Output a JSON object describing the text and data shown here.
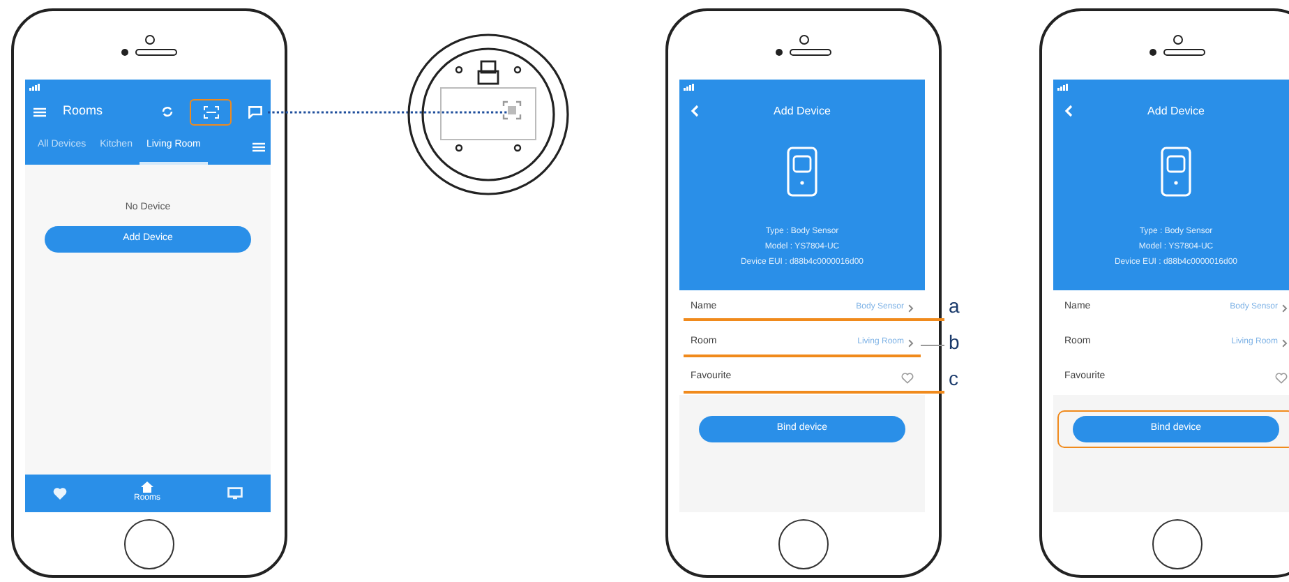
{
  "home_screen": {
    "title": "Rooms",
    "scan_highlighted": true,
    "tabs": [
      {
        "label": "All Devices",
        "selected": false
      },
      {
        "label": "Kitchen",
        "selected": false
      },
      {
        "label": "Living Room",
        "selected": true
      }
    ],
    "empty_text": "No Device",
    "add_button": "Add Device",
    "nav": [
      {
        "kind": "heart",
        "selected": false
      },
      {
        "kind": "home",
        "label": "Rooms",
        "selected": true
      },
      {
        "kind": "monitor",
        "selected": false
      }
    ]
  },
  "add_device_screens": [
    {
      "title": "Add Device",
      "info": [
        "Type : Body Sensor",
        "Model : YS7804-UC",
        "Device EUI : d88b4c0000016d00"
      ],
      "fields": [
        {
          "kind": "link",
          "label": "Name",
          "value": "Body Sensor",
          "callout": "a"
        },
        {
          "kind": "link",
          "label": "Room",
          "value": "Living Room",
          "callout": "b"
        },
        {
          "kind": "favourite",
          "label": "Favourite",
          "favourite": false,
          "callout": "c"
        }
      ],
      "bind_button": "Bind device",
      "button_highlighted": false
    },
    {
      "title": "Add Device",
      "info": [
        "Type : Body Sensor",
        "Model : YS7804-UC",
        "Device EUI : d88b4c0000016d00"
      ],
      "fields": [
        {
          "kind": "link",
          "label": "Name",
          "value": "Body Sensor"
        },
        {
          "kind": "link",
          "label": "Room",
          "value": "Living Room"
        },
        {
          "kind": "favourite",
          "label": "Favourite",
          "favourite": false
        }
      ],
      "bind_button": "Bind device",
      "button_highlighted": true
    }
  ]
}
